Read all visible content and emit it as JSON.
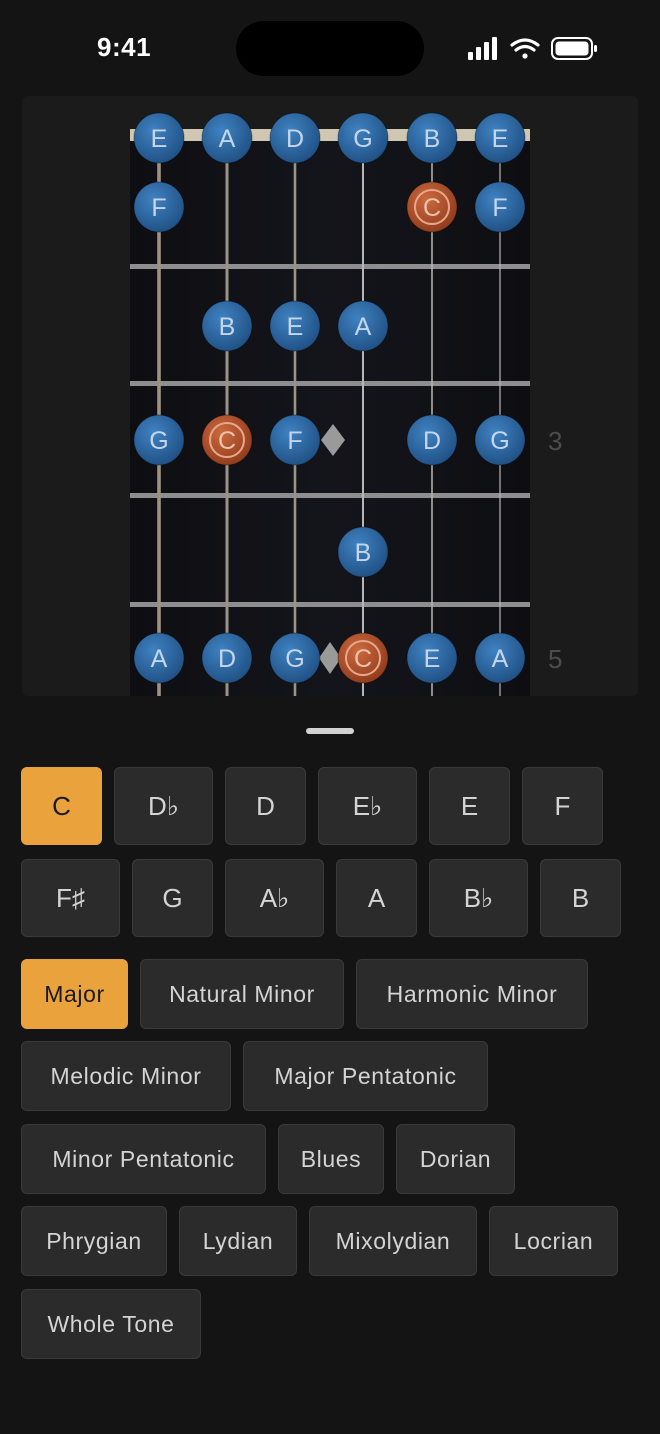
{
  "status_bar": {
    "time": "9:41"
  },
  "fretboard": {
    "string_names": [
      "E",
      "A",
      "D",
      "G",
      "B",
      "E"
    ],
    "fret_numbers": [
      "3",
      "5"
    ],
    "notes": [
      {
        "string": 0,
        "fret": 0,
        "label": "E",
        "root": false
      },
      {
        "string": 1,
        "fret": 0,
        "label": "A",
        "root": false
      },
      {
        "string": 2,
        "fret": 0,
        "label": "D",
        "root": false
      },
      {
        "string": 3,
        "fret": 0,
        "label": "G",
        "root": false
      },
      {
        "string": 4,
        "fret": 0,
        "label": "B",
        "root": false
      },
      {
        "string": 5,
        "fret": 0,
        "label": "E",
        "root": false
      },
      {
        "string": 0,
        "fret": 1,
        "label": "F",
        "root": false
      },
      {
        "string": 4,
        "fret": 1,
        "label": "C",
        "root": true
      },
      {
        "string": 5,
        "fret": 1,
        "label": "F",
        "root": false
      },
      {
        "string": 1,
        "fret": 2,
        "label": "B",
        "root": false
      },
      {
        "string": 2,
        "fret": 2,
        "label": "E",
        "root": false
      },
      {
        "string": 3,
        "fret": 2,
        "label": "A",
        "root": false
      },
      {
        "string": 0,
        "fret": 3,
        "label": "G",
        "root": false
      },
      {
        "string": 1,
        "fret": 3,
        "label": "C",
        "root": true
      },
      {
        "string": 2,
        "fret": 3,
        "label": "F",
        "root": false
      },
      {
        "string": 4,
        "fret": 3,
        "label": "D",
        "root": false
      },
      {
        "string": 5,
        "fret": 3,
        "label": "G",
        "root": false
      },
      {
        "string": 3,
        "fret": 4,
        "label": "B",
        "root": false
      },
      {
        "string": 0,
        "fret": 5,
        "label": "A",
        "root": false
      },
      {
        "string": 1,
        "fret": 5,
        "label": "D",
        "root": false
      },
      {
        "string": 2,
        "fret": 5,
        "label": "G",
        "root": false
      },
      {
        "string": 3,
        "fret": 5,
        "label": "C",
        "root": true
      },
      {
        "string": 4,
        "fret": 5,
        "label": "E",
        "root": false
      },
      {
        "string": 5,
        "fret": 5,
        "label": "A",
        "root": false
      }
    ]
  },
  "keys": {
    "row1": [
      "C",
      "D♭",
      "D",
      "E♭",
      "E",
      "F"
    ],
    "row2": [
      "F♯",
      "G",
      "A♭",
      "A",
      "B♭",
      "B"
    ],
    "selected": "C"
  },
  "scales": {
    "rows": [
      [
        "Major",
        "Natural Minor",
        "Harmonic Minor"
      ],
      [
        "Melodic Minor",
        "Major Pentatonic"
      ],
      [
        "Minor Pentatonic",
        "Blues",
        "Dorian"
      ],
      [
        "Phrygian",
        "Lydian",
        "Mixolydian",
        "Locrian"
      ],
      [
        "Whole Tone"
      ]
    ],
    "selected": "Major"
  },
  "colors": {
    "accent": "#eaa23d",
    "note_blue": "#2f6ca8",
    "note_root": "#b8532c",
    "background": "#141414",
    "button_bg": "#2b2b2b"
  }
}
